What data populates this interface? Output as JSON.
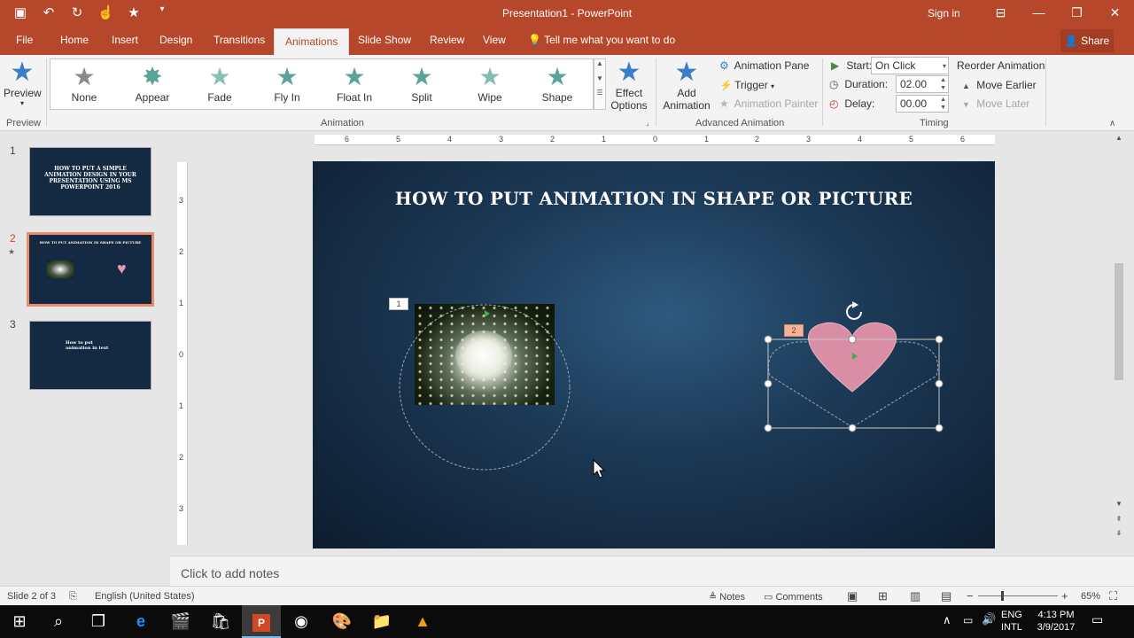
{
  "window": {
    "title": "Presentation1  -  PowerPoint",
    "sign_in": "Sign in",
    "qat_icons": [
      "save-icon",
      "undo-icon",
      "redo-icon",
      "touch-mode-icon",
      "star-icon",
      "customize-icon"
    ]
  },
  "tabs": [
    "File",
    "Home",
    "Insert",
    "Design",
    "Transitions",
    "Animations",
    "Slide Show",
    "Review",
    "View"
  ],
  "active_tab": "Animations",
  "tell_me": "Tell me what you want to do",
  "share": "Share",
  "ribbon": {
    "preview": {
      "label": "Preview",
      "group": "Preview"
    },
    "animations": [
      "None",
      "Appear",
      "Fade",
      "Fly In",
      "Float In",
      "Split",
      "Wipe",
      "Shape"
    ],
    "effect_options": [
      "Effect",
      "Options"
    ],
    "animation_group": "Animation",
    "add_animation": [
      "Add",
      "Animation"
    ],
    "animation_pane": "Animation Pane",
    "trigger": "Trigger",
    "animation_painter": "Animation Painter",
    "advanced_group": "Advanced Animation",
    "start_label": "Start:",
    "start_value": "On Click",
    "duration_label": "Duration:",
    "duration_value": "02.00",
    "delay_label": "Delay:",
    "delay_value": "00.00",
    "reorder": "Reorder Animation",
    "move_earlier": "Move Earlier",
    "move_later": "Move Later",
    "timing_group": "Timing"
  },
  "thumbnails": [
    {
      "num": "1",
      "text": "HOW TO PUT A SIMPLE ANIMATION DESIGN IN YOUR PRESENTATION USING MS POWERPOINT 2016"
    },
    {
      "num": "2",
      "text": "HOW TO PUT ANIMATION IN SHAPE OR PICTURE"
    },
    {
      "num": "3",
      "text": "How to put animation in text"
    }
  ],
  "ruler_h": [
    "6",
    "5",
    "4",
    "3",
    "2",
    "1",
    "0",
    "1",
    "2",
    "3",
    "4",
    "5",
    "6"
  ],
  "ruler_v": [
    "3",
    "2",
    "1",
    "0",
    "1",
    "2",
    "3"
  ],
  "slide": {
    "title": "HOW TO PUT ANIMATION IN SHAPE OR PICTURE",
    "tag1": "1",
    "tag2": "2"
  },
  "notes_placeholder": "Click to add notes",
  "status": {
    "slide": "Slide 2 of 3",
    "language": "English (United States)",
    "notes": "Notes",
    "comments": "Comments",
    "zoom": "65%"
  },
  "tray": {
    "lang_top": "ENG",
    "lang_bottom": "INTL",
    "time": "4:13 PM",
    "date": "3/9/2017"
  }
}
